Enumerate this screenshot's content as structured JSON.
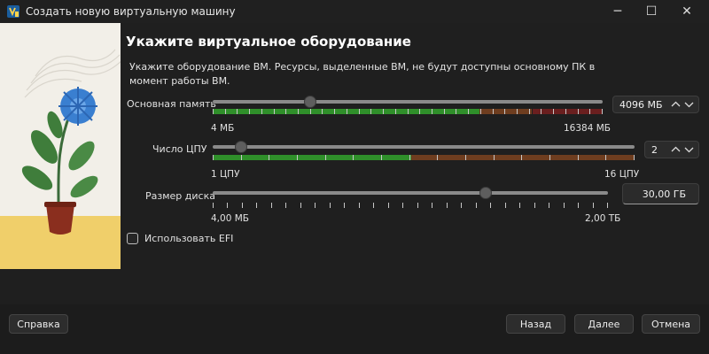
{
  "window": {
    "title": "Создать новую виртуальную машину",
    "icon": "virtualbox-app-icon"
  },
  "titlebar_controls": {
    "minimize": "─",
    "maximize": "☐",
    "close": "✕"
  },
  "page": {
    "heading": "Укажите виртуальное оборудование",
    "description": "Укажите оборудование ВМ. Ресурсы, выделенные ВМ, не будут доступны основному ПК в момент работы ВМ."
  },
  "memory": {
    "label": "Основная память",
    "min_label": "4 МБ",
    "max_label": "16384 МБ",
    "value_text": "4096 МБ",
    "value_mb": 4096,
    "min_mb": 4,
    "max_mb": 16384,
    "zones": {
      "green": "#2f8f2a",
      "amber": "#6e3d1f",
      "red": "#6a1f1f"
    }
  },
  "cpu": {
    "label": "Число ЦПУ",
    "min_label": "1 ЦПУ",
    "max_label": "16 ЦПУ",
    "value_text": "2",
    "value": 2,
    "min": 1,
    "max": 16,
    "zones": {
      "green": "#2f8f2a",
      "amber": "#6e3d1f"
    }
  },
  "disk": {
    "label": "Размер диска",
    "min_label": "4,00 МБ",
    "max_label": "2,00 ТБ",
    "value_text": "30,00 ГБ",
    "slider_position": 0.69
  },
  "efi": {
    "label": "Использовать EFI",
    "checked": false
  },
  "buttons": {
    "help": "Справка",
    "back": "Назад",
    "next": "Далее",
    "cancel": "Отмена"
  },
  "colors": {
    "background": "#1f1f1f",
    "accent_green": "#2f8f2a",
    "text": "#e8e8e8"
  }
}
